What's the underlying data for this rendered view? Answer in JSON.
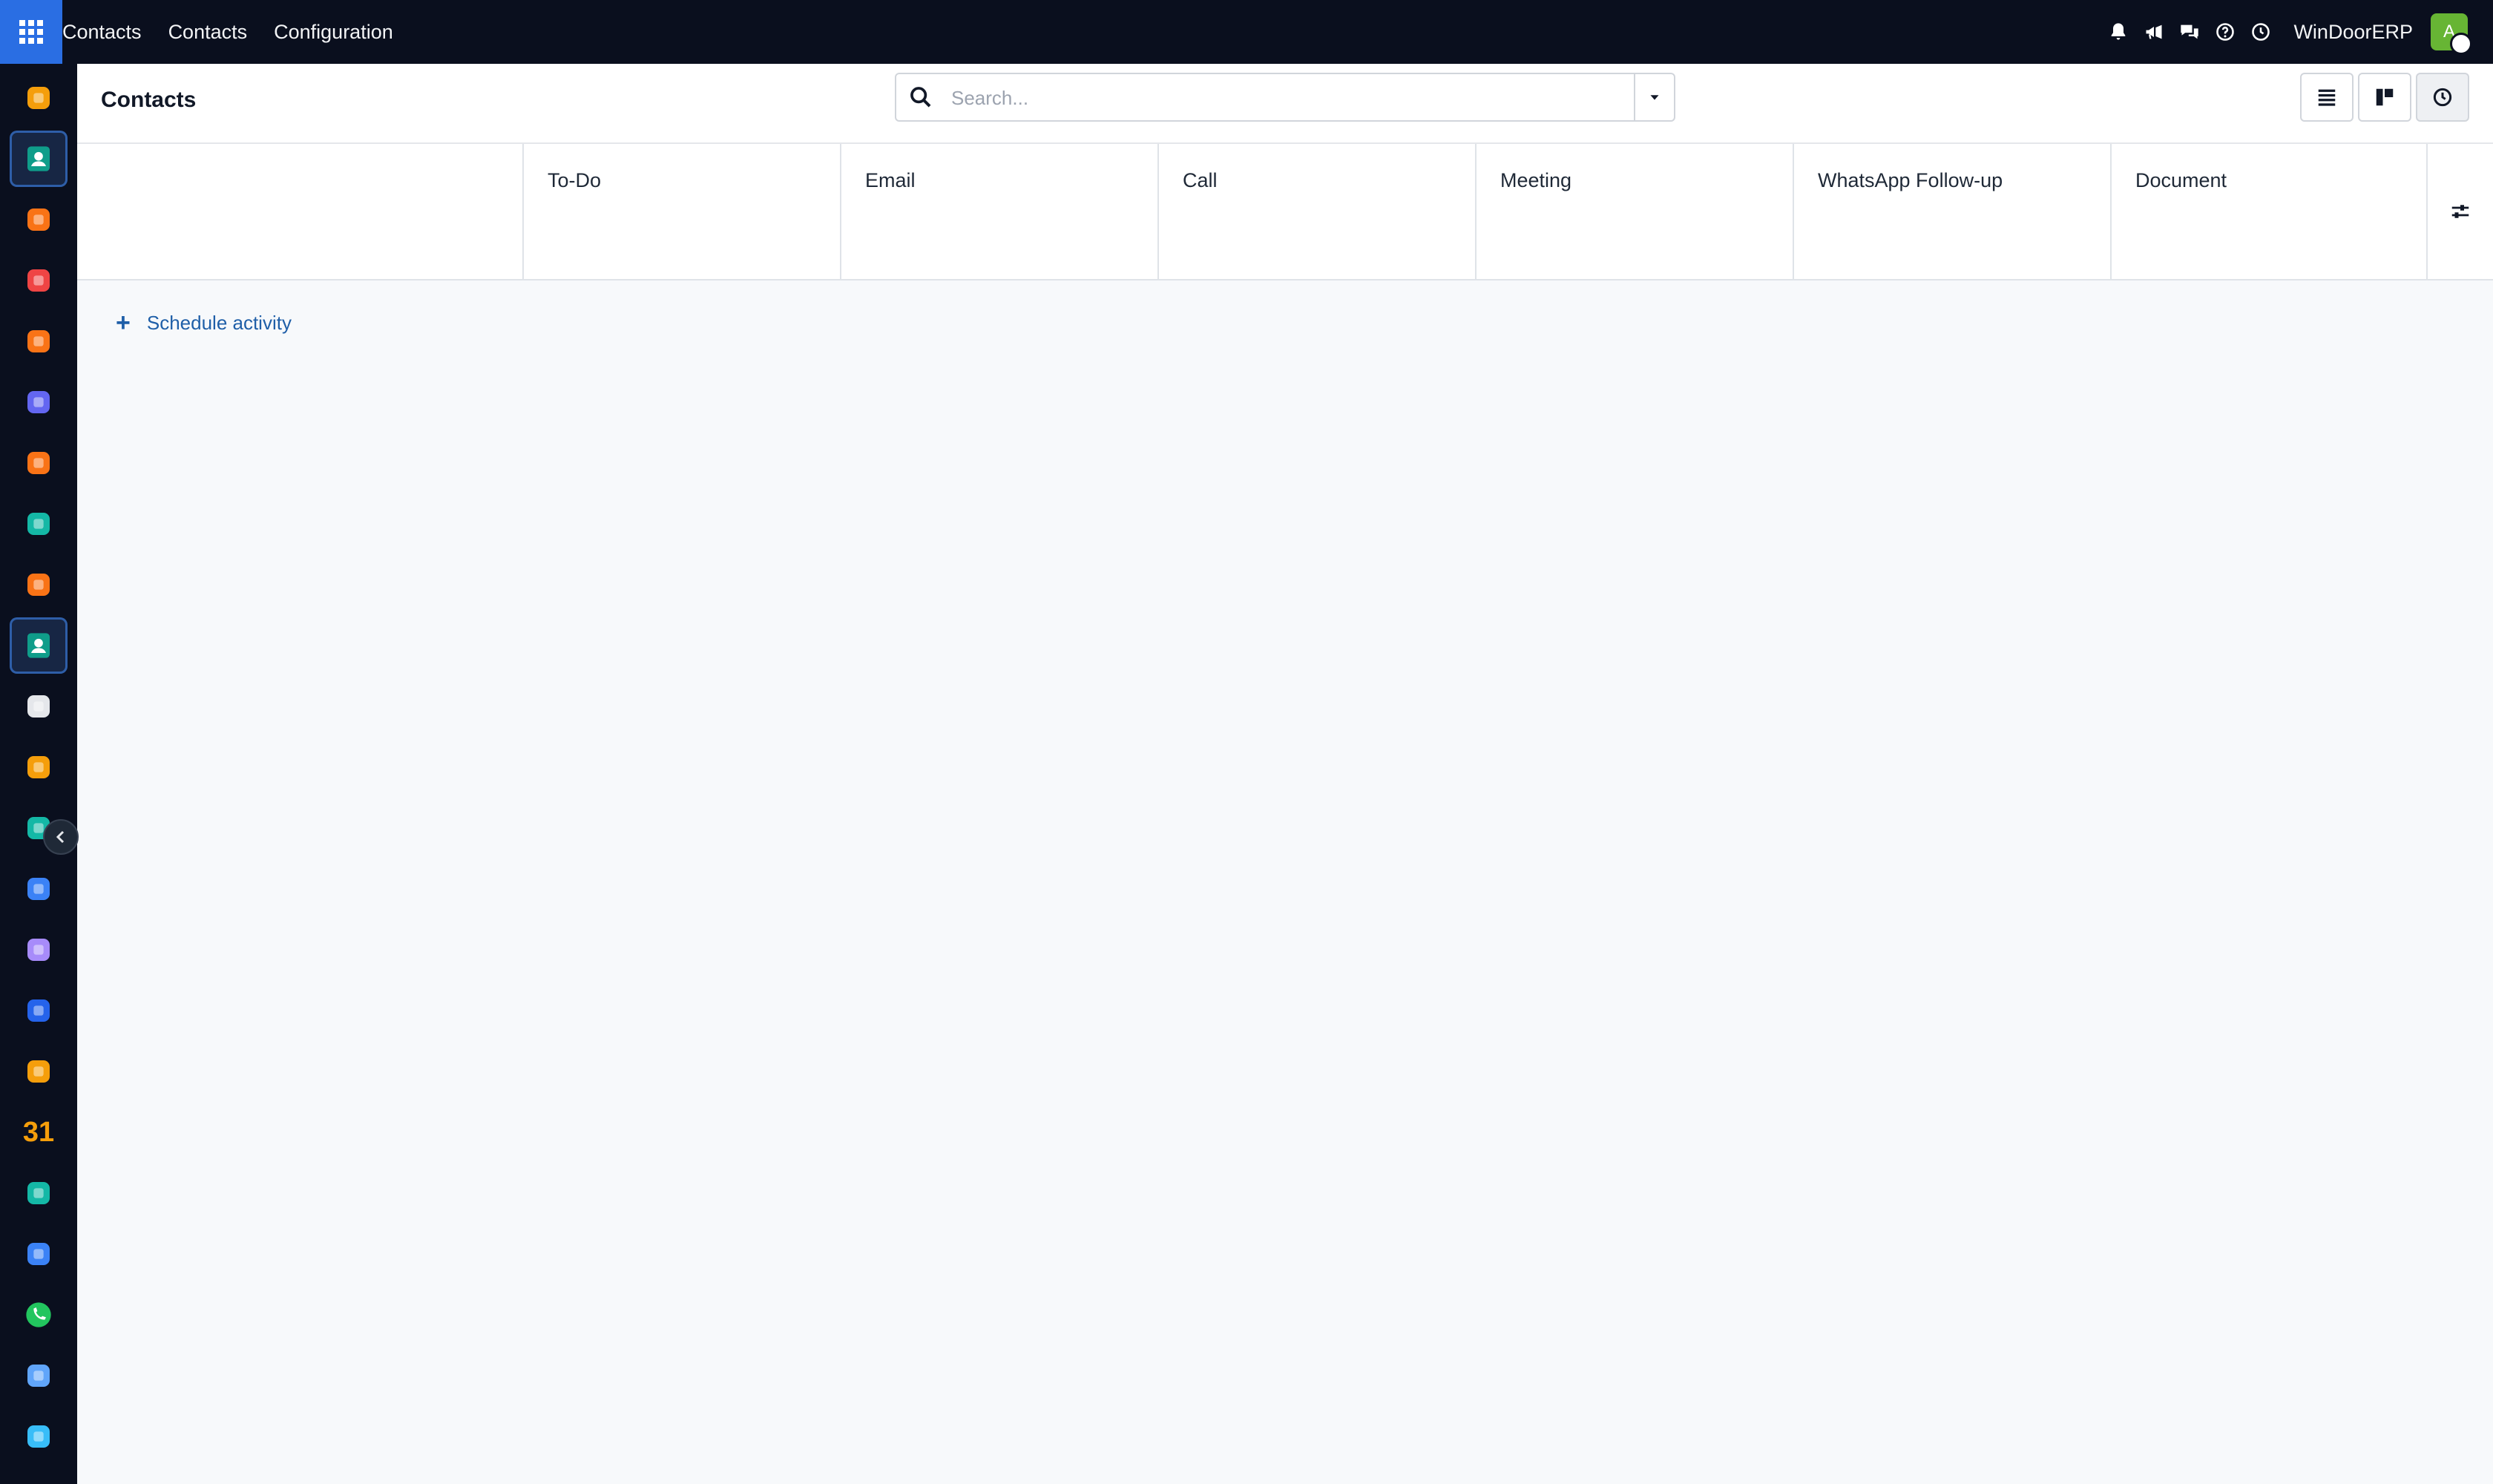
{
  "navbar": {
    "menu": [
      "Contacts",
      "Contacts",
      "Configuration"
    ],
    "company": "WinDoorERP",
    "avatar_initial": "A",
    "icons": [
      "bell-icon",
      "megaphone-icon",
      "chat-icon",
      "help-icon",
      "clock-icon"
    ]
  },
  "sidebar": {
    "apps": [
      {
        "name": "app-1",
        "color": "#f59e0b",
        "active": false
      },
      {
        "name": "contacts",
        "color": "#0f9d8a",
        "active": true
      },
      {
        "name": "app-3",
        "color": "#f97316",
        "active": false
      },
      {
        "name": "app-4",
        "color": "#ef4444",
        "active": false
      },
      {
        "name": "app-5",
        "color": "#f97316",
        "active": false
      },
      {
        "name": "app-6",
        "color": "#6366f1",
        "active": false
      },
      {
        "name": "app-7",
        "color": "#f97316",
        "active": false
      },
      {
        "name": "app-8",
        "color": "#14b8a6",
        "active": false
      },
      {
        "name": "app-9",
        "color": "#f97316",
        "active": false
      },
      {
        "name": "contacts-2",
        "color": "#0f9d8a",
        "active": true
      },
      {
        "name": "app-11",
        "color": "#e5e7eb",
        "active": false
      },
      {
        "name": "app-12",
        "color": "#f59e0b",
        "active": false
      },
      {
        "name": "app-13",
        "color": "#14b8a6",
        "active": false
      },
      {
        "name": "app-14",
        "color": "#3b82f6",
        "active": false
      },
      {
        "name": "app-15",
        "color": "#a78bfa",
        "active": false
      },
      {
        "name": "app-16",
        "color": "#2563eb",
        "active": false
      },
      {
        "name": "app-17",
        "color": "#f59e0b",
        "active": false
      },
      {
        "name": "calendar",
        "color": "#f59e0b",
        "active": false
      },
      {
        "name": "app-19",
        "color": "#14b8a6",
        "active": false
      },
      {
        "name": "app-20",
        "color": "#3b82f6",
        "active": false
      },
      {
        "name": "whatsapp",
        "color": "#22c55e",
        "active": false
      },
      {
        "name": "app-22",
        "color": "#60a5fa",
        "active": false
      },
      {
        "name": "app-23",
        "color": "#38bdf8",
        "active": false
      }
    ],
    "calendar_label": "31"
  },
  "control": {
    "title": "Contacts",
    "search_placeholder": "Search..."
  },
  "activity": {
    "columns": [
      "To-Do",
      "Email",
      "Call",
      "Meeting",
      "WhatsApp Follow-up",
      "Document"
    ],
    "schedule_label": "Schedule activity"
  }
}
